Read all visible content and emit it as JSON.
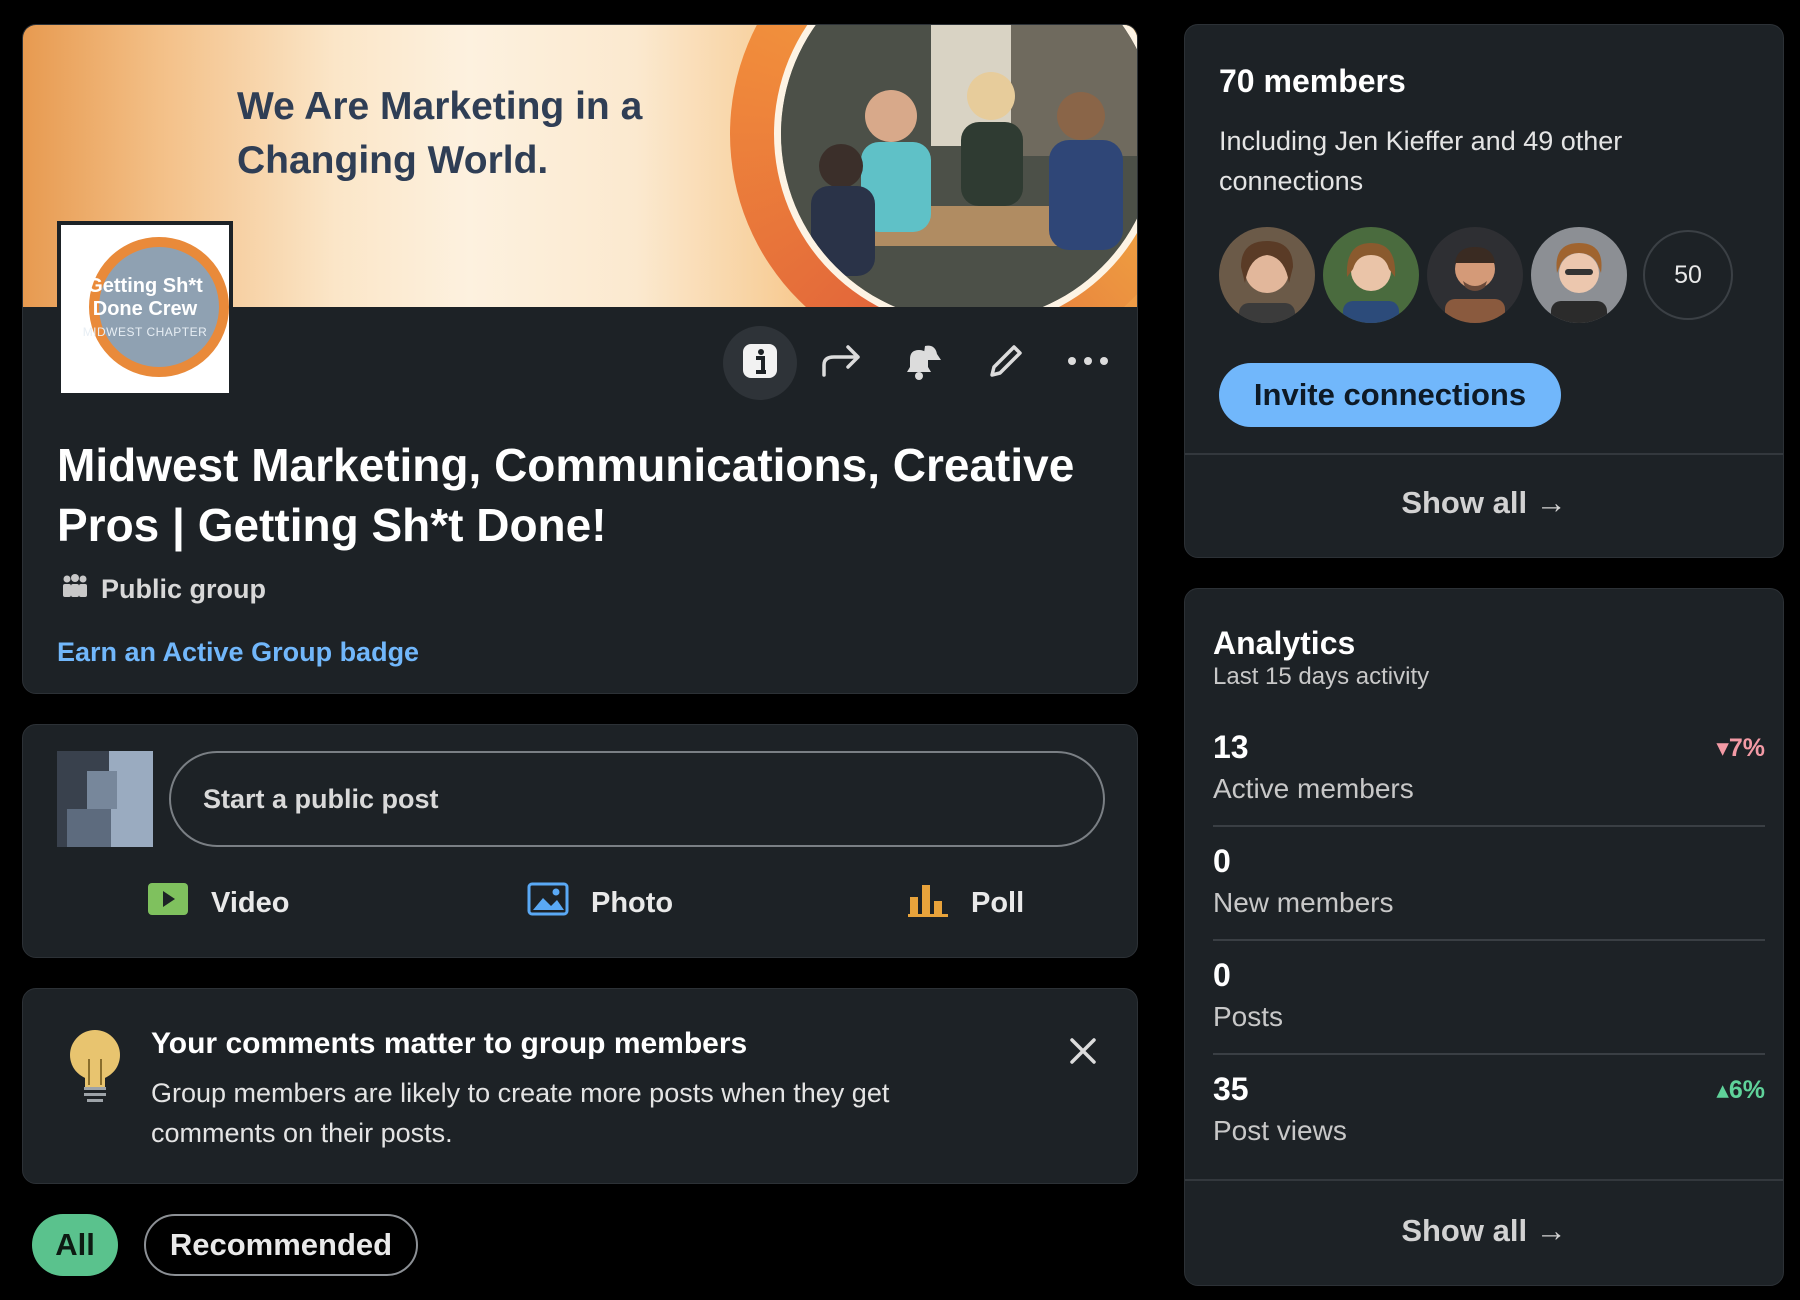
{
  "group": {
    "banner_title": "We Are Marketing in a Changing World.",
    "logo_title": "Getting Sh*t Done Crew",
    "logo_subtitle": "MIDWEST CHAPTER",
    "name": "Midwest Marketing, Communications, Creative Pros | Getting Sh*t Done!",
    "type": "Public group",
    "badge_link": "Earn an Active Group badge",
    "toolbar_icons": [
      "info-icon",
      "share-icon",
      "notification-bell-icon",
      "edit-pencil-icon",
      "more-options-icon"
    ]
  },
  "composer": {
    "placeholder": "Start a public post",
    "actions": [
      {
        "label": "Video",
        "icon": "video-icon",
        "color": "#7fc15e"
      },
      {
        "label": "Photo",
        "icon": "photo-icon",
        "color": "#5aa9f5"
      },
      {
        "label": "Poll",
        "icon": "poll-icon",
        "color": "#e8a33b"
      }
    ]
  },
  "tip": {
    "title": "Your comments matter to group members",
    "body": "Group members are likely to create more posts when they get comments on their posts."
  },
  "filters": {
    "all": "All",
    "recommended": "Recommended"
  },
  "members": {
    "count": "70 members",
    "subtitle": "Including Jen Kieffer and 49 other connections",
    "more_count": "50",
    "invite_label": "Invite connections",
    "show_all": "Show all →"
  },
  "analytics": {
    "title": "Analytics",
    "subtitle": "Last 15 days activity",
    "stats": [
      {
        "value": "13",
        "label": "Active members",
        "delta": "▾7%",
        "trend": "down"
      },
      {
        "value": "0",
        "label": "New members",
        "delta": "",
        "trend": ""
      },
      {
        "value": "0",
        "label": "Posts",
        "delta": "",
        "trend": ""
      },
      {
        "value": "35",
        "label": "Post views",
        "delta": "▴6%",
        "trend": "up"
      }
    ],
    "show_all": "Show all →"
  },
  "colors": {
    "accent_blue": "#71b7fb",
    "pill_green": "#5ac28d",
    "card_bg": "#1d2226"
  }
}
